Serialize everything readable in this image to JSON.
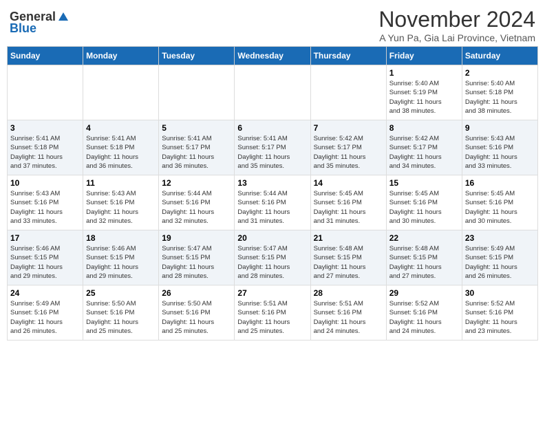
{
  "header": {
    "logo_general": "General",
    "logo_blue": "Blue",
    "month_title": "November 2024",
    "location": "A Yun Pa, Gia Lai Province, Vietnam"
  },
  "weekdays": [
    "Sunday",
    "Monday",
    "Tuesday",
    "Wednesday",
    "Thursday",
    "Friday",
    "Saturday"
  ],
  "weeks": [
    [
      {
        "day": "",
        "info": ""
      },
      {
        "day": "",
        "info": ""
      },
      {
        "day": "",
        "info": ""
      },
      {
        "day": "",
        "info": ""
      },
      {
        "day": "",
        "info": ""
      },
      {
        "day": "1",
        "info": "Sunrise: 5:40 AM\nSunset: 5:19 PM\nDaylight: 11 hours\nand 38 minutes."
      },
      {
        "day": "2",
        "info": "Sunrise: 5:40 AM\nSunset: 5:18 PM\nDaylight: 11 hours\nand 38 minutes."
      }
    ],
    [
      {
        "day": "3",
        "info": "Sunrise: 5:41 AM\nSunset: 5:18 PM\nDaylight: 11 hours\nand 37 minutes."
      },
      {
        "day": "4",
        "info": "Sunrise: 5:41 AM\nSunset: 5:18 PM\nDaylight: 11 hours\nand 36 minutes."
      },
      {
        "day": "5",
        "info": "Sunrise: 5:41 AM\nSunset: 5:17 PM\nDaylight: 11 hours\nand 36 minutes."
      },
      {
        "day": "6",
        "info": "Sunrise: 5:41 AM\nSunset: 5:17 PM\nDaylight: 11 hours\nand 35 minutes."
      },
      {
        "day": "7",
        "info": "Sunrise: 5:42 AM\nSunset: 5:17 PM\nDaylight: 11 hours\nand 35 minutes."
      },
      {
        "day": "8",
        "info": "Sunrise: 5:42 AM\nSunset: 5:17 PM\nDaylight: 11 hours\nand 34 minutes."
      },
      {
        "day": "9",
        "info": "Sunrise: 5:43 AM\nSunset: 5:16 PM\nDaylight: 11 hours\nand 33 minutes."
      }
    ],
    [
      {
        "day": "10",
        "info": "Sunrise: 5:43 AM\nSunset: 5:16 PM\nDaylight: 11 hours\nand 33 minutes."
      },
      {
        "day": "11",
        "info": "Sunrise: 5:43 AM\nSunset: 5:16 PM\nDaylight: 11 hours\nand 32 minutes."
      },
      {
        "day": "12",
        "info": "Sunrise: 5:44 AM\nSunset: 5:16 PM\nDaylight: 11 hours\nand 32 minutes."
      },
      {
        "day": "13",
        "info": "Sunrise: 5:44 AM\nSunset: 5:16 PM\nDaylight: 11 hours\nand 31 minutes."
      },
      {
        "day": "14",
        "info": "Sunrise: 5:45 AM\nSunset: 5:16 PM\nDaylight: 11 hours\nand 31 minutes."
      },
      {
        "day": "15",
        "info": "Sunrise: 5:45 AM\nSunset: 5:16 PM\nDaylight: 11 hours\nand 30 minutes."
      },
      {
        "day": "16",
        "info": "Sunrise: 5:45 AM\nSunset: 5:16 PM\nDaylight: 11 hours\nand 30 minutes."
      }
    ],
    [
      {
        "day": "17",
        "info": "Sunrise: 5:46 AM\nSunset: 5:15 PM\nDaylight: 11 hours\nand 29 minutes."
      },
      {
        "day": "18",
        "info": "Sunrise: 5:46 AM\nSunset: 5:15 PM\nDaylight: 11 hours\nand 29 minutes."
      },
      {
        "day": "19",
        "info": "Sunrise: 5:47 AM\nSunset: 5:15 PM\nDaylight: 11 hours\nand 28 minutes."
      },
      {
        "day": "20",
        "info": "Sunrise: 5:47 AM\nSunset: 5:15 PM\nDaylight: 11 hours\nand 28 minutes."
      },
      {
        "day": "21",
        "info": "Sunrise: 5:48 AM\nSunset: 5:15 PM\nDaylight: 11 hours\nand 27 minutes."
      },
      {
        "day": "22",
        "info": "Sunrise: 5:48 AM\nSunset: 5:15 PM\nDaylight: 11 hours\nand 27 minutes."
      },
      {
        "day": "23",
        "info": "Sunrise: 5:49 AM\nSunset: 5:15 PM\nDaylight: 11 hours\nand 26 minutes."
      }
    ],
    [
      {
        "day": "24",
        "info": "Sunrise: 5:49 AM\nSunset: 5:16 PM\nDaylight: 11 hours\nand 26 minutes."
      },
      {
        "day": "25",
        "info": "Sunrise: 5:50 AM\nSunset: 5:16 PM\nDaylight: 11 hours\nand 25 minutes."
      },
      {
        "day": "26",
        "info": "Sunrise: 5:50 AM\nSunset: 5:16 PM\nDaylight: 11 hours\nand 25 minutes."
      },
      {
        "day": "27",
        "info": "Sunrise: 5:51 AM\nSunset: 5:16 PM\nDaylight: 11 hours\nand 25 minutes."
      },
      {
        "day": "28",
        "info": "Sunrise: 5:51 AM\nSunset: 5:16 PM\nDaylight: 11 hours\nand 24 minutes."
      },
      {
        "day": "29",
        "info": "Sunrise: 5:52 AM\nSunset: 5:16 PM\nDaylight: 11 hours\nand 24 minutes."
      },
      {
        "day": "30",
        "info": "Sunrise: 5:52 AM\nSunset: 5:16 PM\nDaylight: 11 hours\nand 23 minutes."
      }
    ]
  ]
}
